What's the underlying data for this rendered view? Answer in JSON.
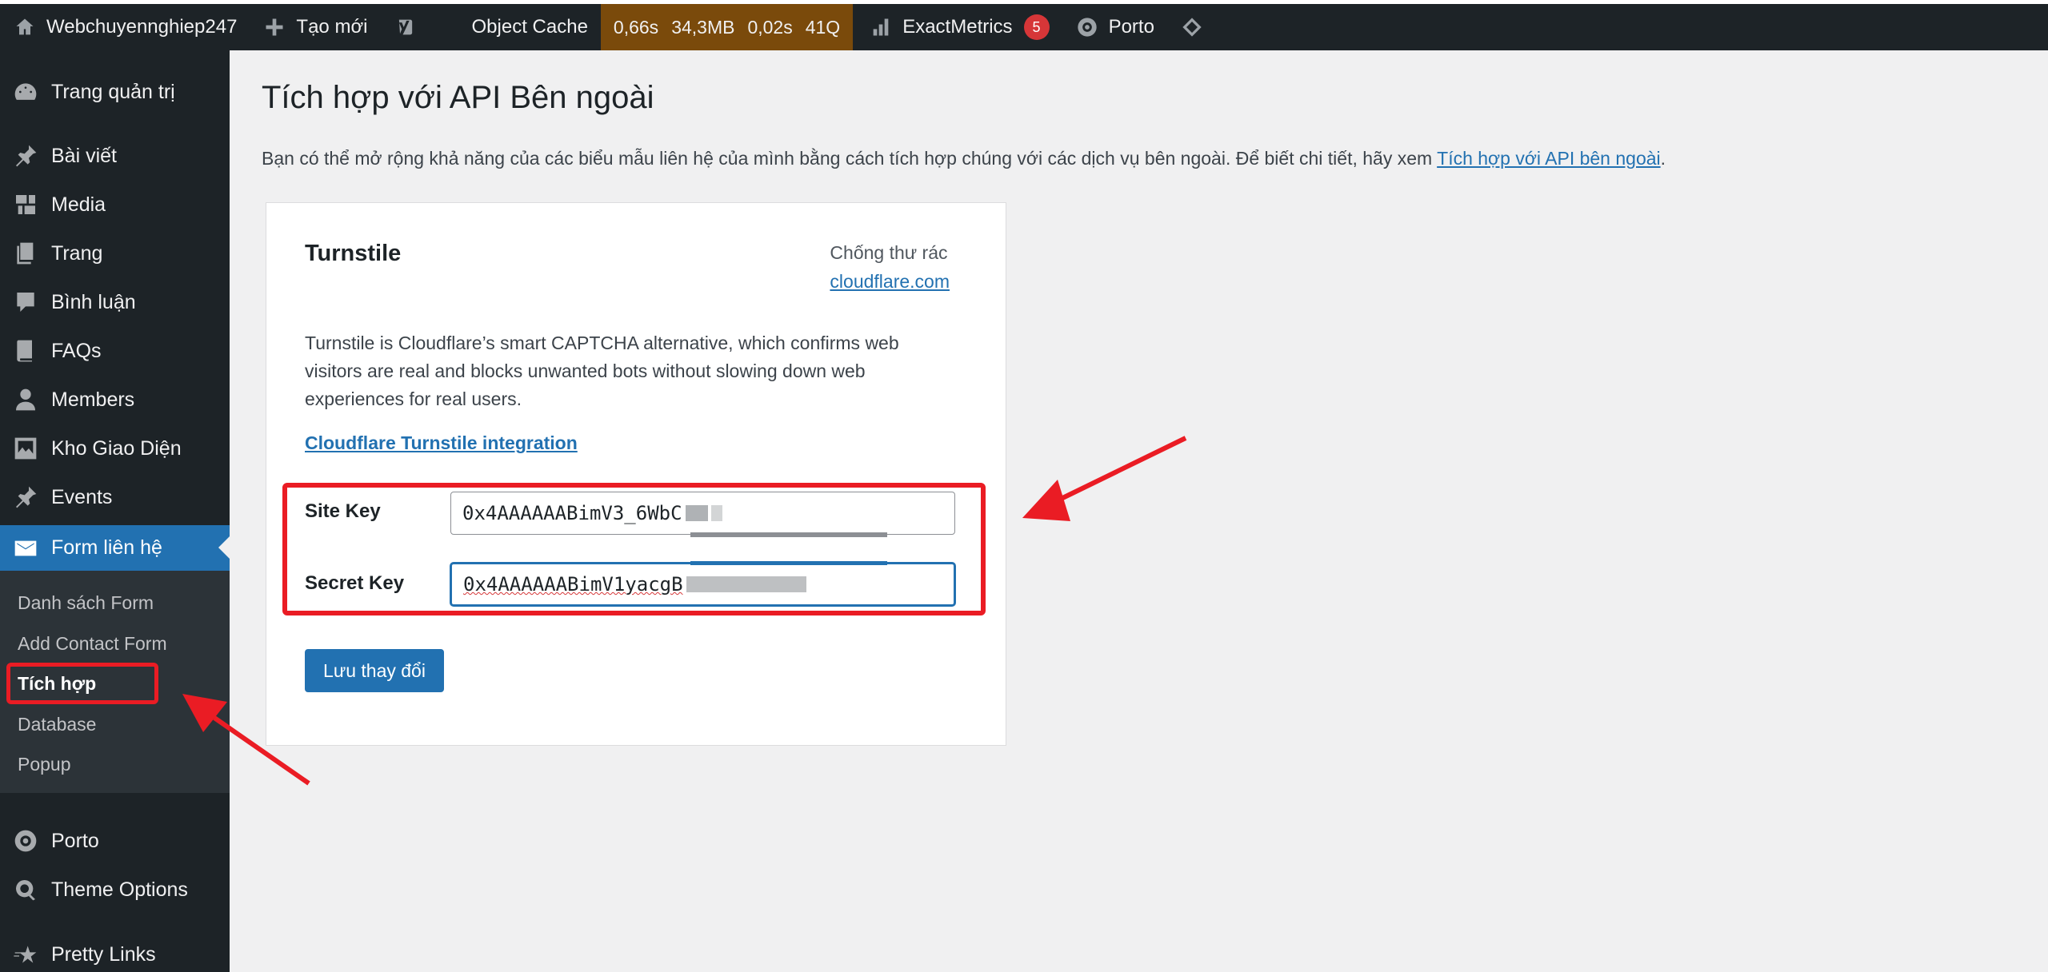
{
  "adminbar": {
    "site_name": "Webchuyennghiep247",
    "new_label": "Tạo mới",
    "object_cache": "Object Cache",
    "perf": [
      "0,66s",
      "34,3MB",
      "0,02s",
      "41Q"
    ],
    "exactmetrics": "ExactMetrics",
    "exactmetrics_count": "5",
    "porto": "Porto"
  },
  "sidebar": {
    "items": [
      {
        "label": "Trang quản trị",
        "icon": "dashboard-icon"
      },
      {
        "label": "Bài viết",
        "icon": "pin-icon"
      },
      {
        "label": "Media",
        "icon": "media-icon"
      },
      {
        "label": "Trang",
        "icon": "page-icon"
      },
      {
        "label": "Bình luận",
        "icon": "comment-icon"
      },
      {
        "label": "FAQs",
        "icon": "book-icon"
      },
      {
        "label": "Members",
        "icon": "user-icon"
      },
      {
        "label": "Kho Giao Diện",
        "icon": "gallery-icon"
      },
      {
        "label": "Events",
        "icon": "pin-icon"
      },
      {
        "label": "Form liên hệ",
        "icon": "mail-icon"
      },
      {
        "label": "Porto",
        "icon": "porto-icon"
      },
      {
        "label": "Theme Options",
        "icon": "gear-search-icon"
      },
      {
        "label": "Pretty Links",
        "icon": "star-icon"
      }
    ],
    "submenu": [
      "Danh sách Form",
      "Add Contact Form",
      "Tích hợp",
      "Database",
      "Popup"
    ]
  },
  "main": {
    "title": "Tích hợp với API Bên ngoài",
    "intro_text": "Bạn có thể mở rộng khả năng của các biểu mẫu liên hệ của mình bằng cách tích hợp chúng với các dịch vụ bên ngoài. Để biết chi tiết, hãy xem ",
    "intro_link": "Tích hợp với API bên ngoài",
    "intro_end": "."
  },
  "card": {
    "title": "Turnstile",
    "category": "Chống thư rác",
    "category_link": "cloudflare.com",
    "description": "Turnstile is Cloudflare’s smart CAPTCHA alternative, which confirms web visitors are real and blocks unwanted bots without slowing down web experiences for real users.",
    "integration_link": "Cloudflare Turnstile integration",
    "site_key_label": "Site Key",
    "site_key_value": "0x4AAAAAABimV3_6WbC",
    "secret_key_label": "Secret Key",
    "secret_key_value": "0x4AAAAAABimV1yacgB",
    "save_label": "Lưu thay đổi"
  },
  "colors": {
    "adminbar_bg": "#1d2327",
    "perf_bg": "#7a4a0b",
    "accent": "#2271b1",
    "annotation": "#ea1c24",
    "badge": "#d63638"
  }
}
